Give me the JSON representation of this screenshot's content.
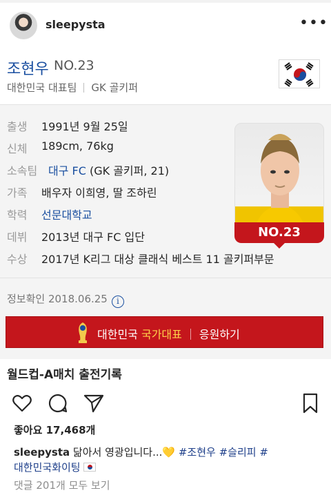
{
  "post": {
    "username": "sleepysta",
    "more_icon": "more-horizontal-icon"
  },
  "card": {
    "name": "조현우",
    "number": "NO.23",
    "team": "대한민국 대표팀",
    "position": "GK 골키퍼",
    "info": [
      {
        "label": "출생",
        "value": "1991년 9월 25일"
      },
      {
        "label": "신체",
        "value": "189cm, 76kg"
      },
      {
        "label": "소속팀",
        "value_link": "대구 FC",
        "value_rest": " (GK 골키퍼, 21)"
      },
      {
        "label": "가족",
        "value": "배우자 이희영, 딸 조하린"
      },
      {
        "label": "학력",
        "value_link": "선문대학교"
      },
      {
        "label": "데뷔",
        "value": "2013년 대구 FC 입단"
      },
      {
        "label": "수상",
        "value": "2017년 K리그 대상 클래식 베스트 11 골키퍼부문"
      }
    ],
    "photo_number": "NO.23",
    "verify_text": "정보확인 2018.06.25",
    "banner": {
      "country": "대한민국",
      "accent": "국가대표",
      "cheer": "응원하기"
    },
    "records_title": "월드컵-A매치 출전기록"
  },
  "actions": {
    "like_icon": "heart-icon",
    "comment_icon": "comment-icon",
    "share_icon": "send-icon",
    "save_icon": "bookmark-icon"
  },
  "likes": "좋아요 17,468개",
  "caption": {
    "username": "sleepysta",
    "text": " 닮아서 영광입니다...💛 ",
    "tags_line1": "#조현우 #슬리피 #",
    "line2": "대한민국화이팅"
  },
  "comments_link": "댓글 201개 모두 보기",
  "colors": {
    "accent_blue": "#1a4fa0",
    "banner_red": "#c4161c",
    "hashtag": "#1e3f8a"
  }
}
